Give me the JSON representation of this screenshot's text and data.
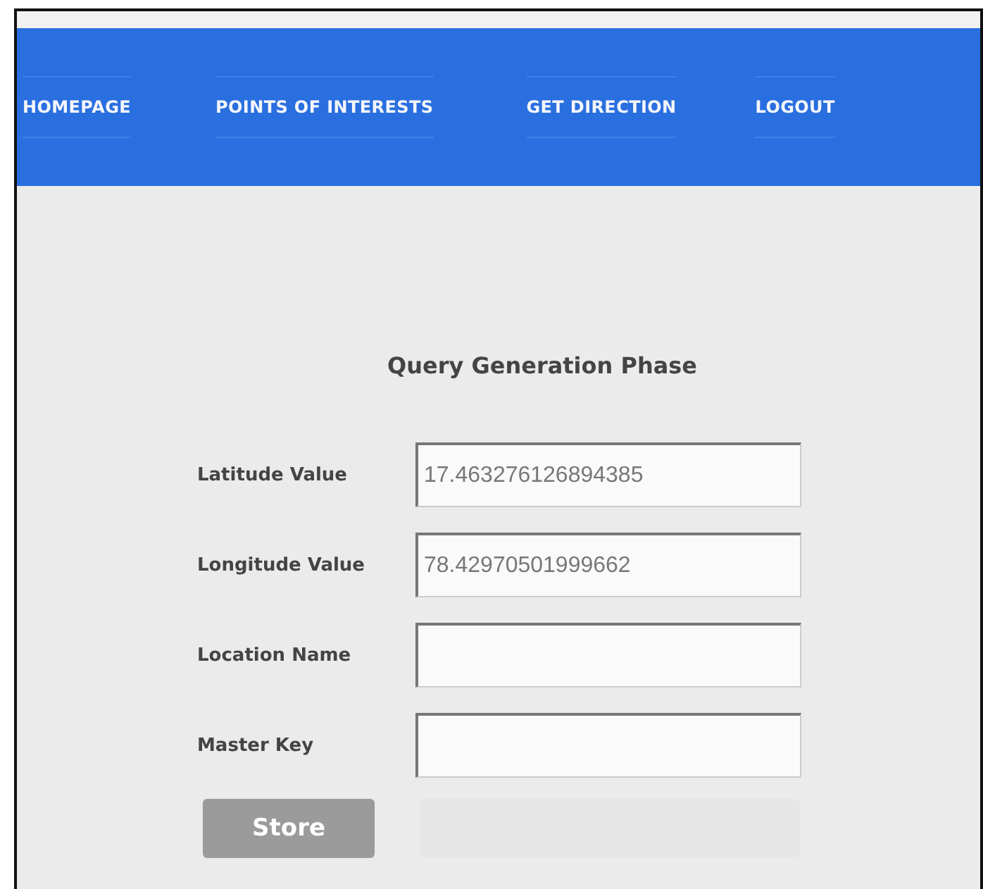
{
  "nav": {
    "items": [
      {
        "label": "HOMEPAGE"
      },
      {
        "label": "POINTS OF INTERESTS"
      },
      {
        "label": "GET DIRECTION"
      },
      {
        "label": "LOGOUT"
      }
    ]
  },
  "form": {
    "title": "Query Generation Phase",
    "fields": [
      {
        "label": "Latitude Value",
        "value": "17.463276126894385"
      },
      {
        "label": "Longitude Value",
        "value": "78.42970501999662"
      },
      {
        "label": "Location Name"
      },
      {
        "label": "Master Key"
      }
    ],
    "button": "Store"
  }
}
